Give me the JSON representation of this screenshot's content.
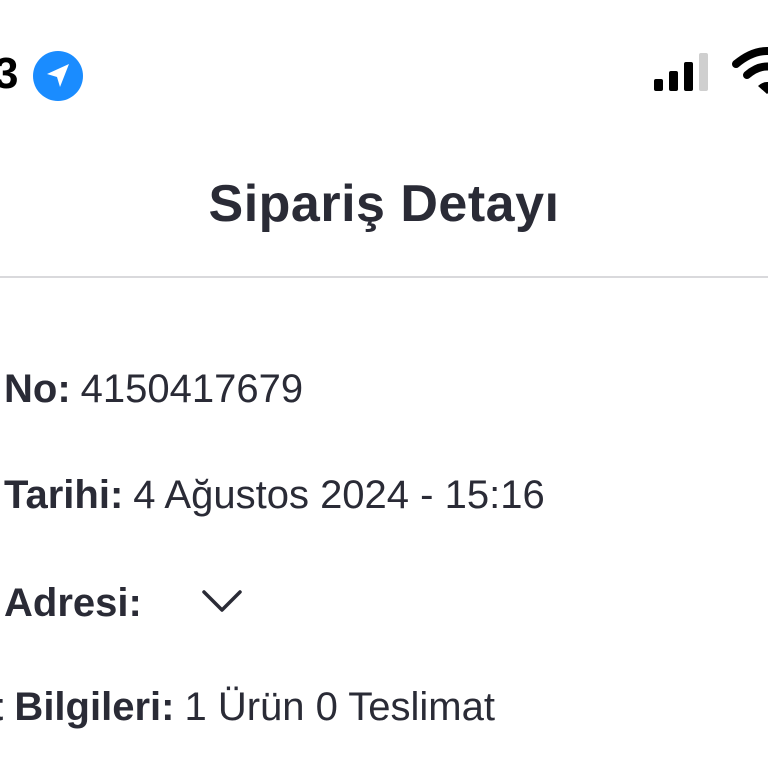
{
  "status_bar": {
    "time": "3",
    "icons": [
      "location-arrow-icon",
      "cellular-signal-icon",
      "wifi-icon"
    ],
    "location_color": "#1a8cff"
  },
  "header": {
    "title": "Sipariş Detayı"
  },
  "details": {
    "order_no_label": "No:",
    "order_no_value": "4150417679",
    "order_date_label": "Tarihi:",
    "order_date_value": "4 Ağustos 2024 - 15:16",
    "address_label": "Adresi:",
    "address_toggle_icon": "chevron-down-icon",
    "shipment_label": "t Bilgileri:",
    "shipment_value": "1 Ürün 0 Teslimat"
  }
}
